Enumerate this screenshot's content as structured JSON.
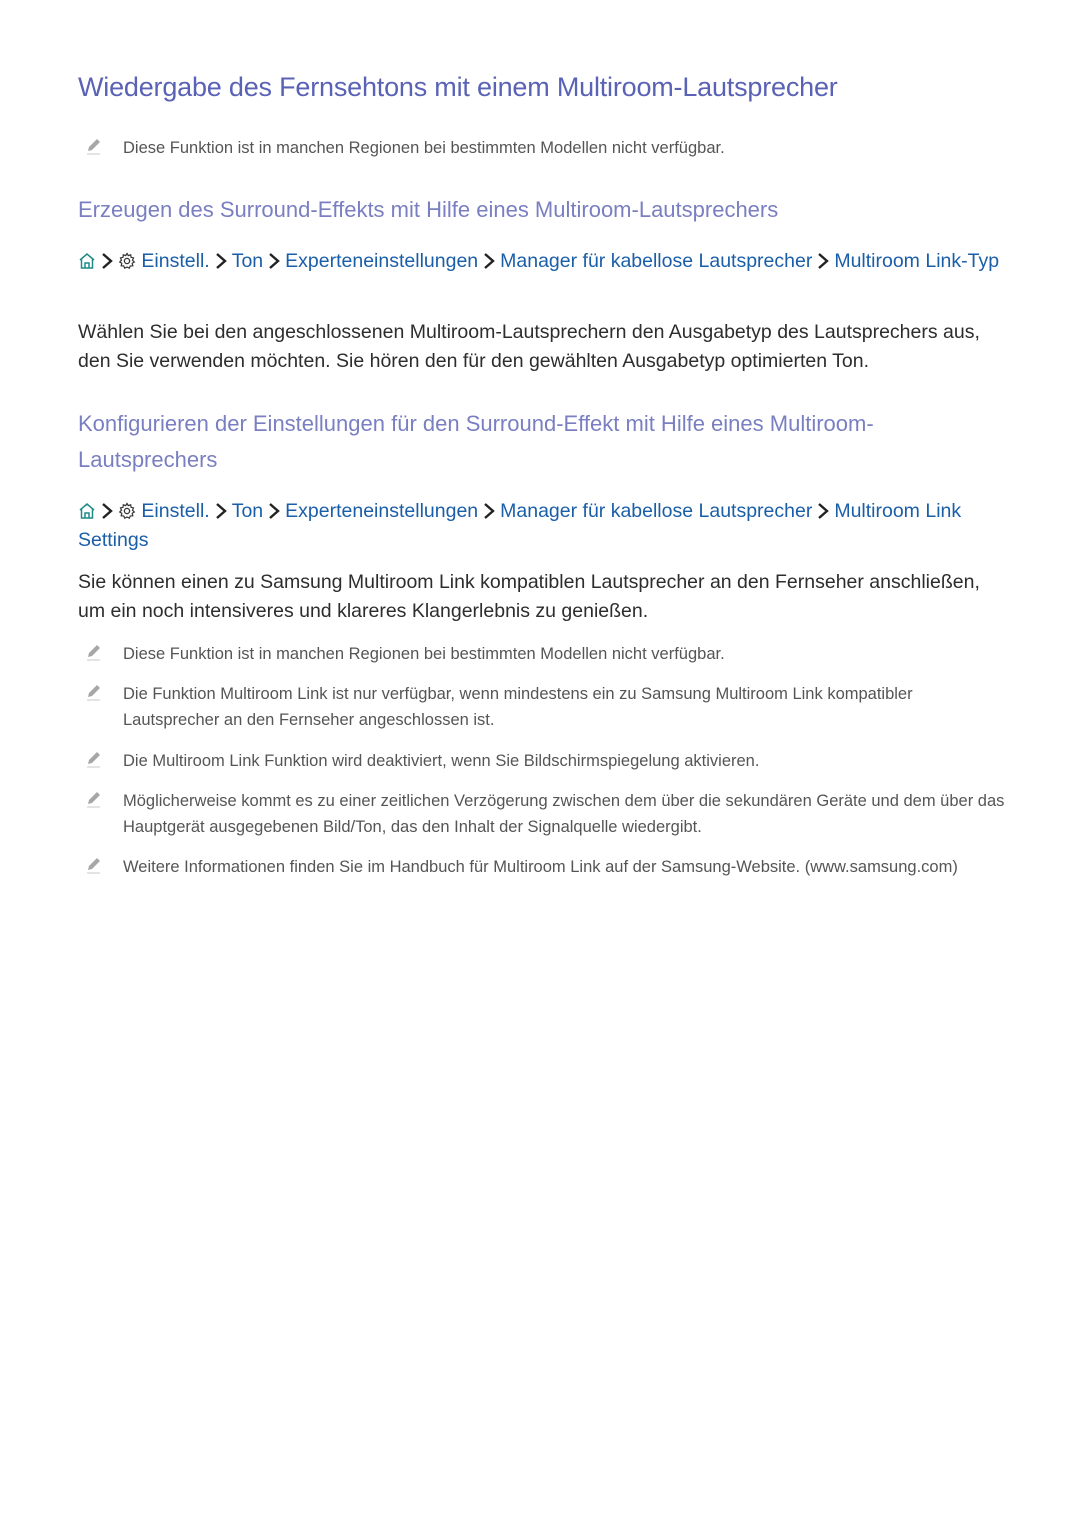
{
  "colors": {
    "heading1": "#5a62b6",
    "heading2": "#7a7fc2",
    "link": "#1b5ea8",
    "body": "#2d2d2d",
    "note": "#555555"
  },
  "title": "Wiedergabe des Fernsehtons mit einem Multiroom-Lautsprecher",
  "intro_note": "Diese Funktion ist in manchen Regionen bei bestimmten Modellen nicht verfügbar.",
  "section1": {
    "heading": "Erzeugen des Surround-Effekts mit Hilfe eines Multiroom-Lautsprechers",
    "path": {
      "home_icon": "home-icon",
      "settings_icon": "gear-icon",
      "items": [
        "Einstell.",
        "Ton",
        "Experteneinstellungen",
        "Manager für kabellose Lautsprecher",
        "Multiroom Link-Typ"
      ]
    },
    "body": "Wählen Sie bei den angeschlossenen Multiroom-Lautsprechern den Ausgabetyp des Lautsprechers aus, den Sie verwenden möchten. Sie hören den für den gewählten Ausgabetyp optimierten Ton."
  },
  "section2": {
    "heading": "Konfigurieren der Einstellungen für den Surround-Effekt mit Hilfe eines Multiroom-Lautsprechers",
    "path": {
      "home_icon": "home-icon",
      "settings_icon": "gear-icon",
      "items": [
        "Einstell.",
        "Ton",
        "Experteneinstellungen",
        "Manager für kabellose Lautsprecher",
        "Multiroom Link Settings"
      ]
    },
    "body": "Sie können einen zu Samsung Multiroom Link kompatiblen Lautsprecher an den Fernseher anschließen, um ein noch intensiveres und klareres Klangerlebnis zu genießen.",
    "notes": [
      "Diese Funktion ist in manchen Regionen bei bestimmten Modellen nicht verfügbar.",
      "Die Funktion Multiroom Link ist nur verfügbar, wenn mindestens ein zu Samsung Multiroom Link kompatibler Lautsprecher an den Fernseher angeschlossen ist.",
      "Die Multiroom Link Funktion wird deaktiviert, wenn Sie Bildschirmspiegelung aktivieren.",
      "Möglicherweise kommt es zu einer zeitlichen Verzögerung zwischen dem über die sekundären Geräte und dem über das Hauptgerät ausgegebenen Bild/Ton, das den Inhalt der Signalquelle wiedergibt.",
      "Weitere Informationen finden Sie im Handbuch für Multiroom Link auf der Samsung-Website. (www.samsung.com)"
    ]
  }
}
